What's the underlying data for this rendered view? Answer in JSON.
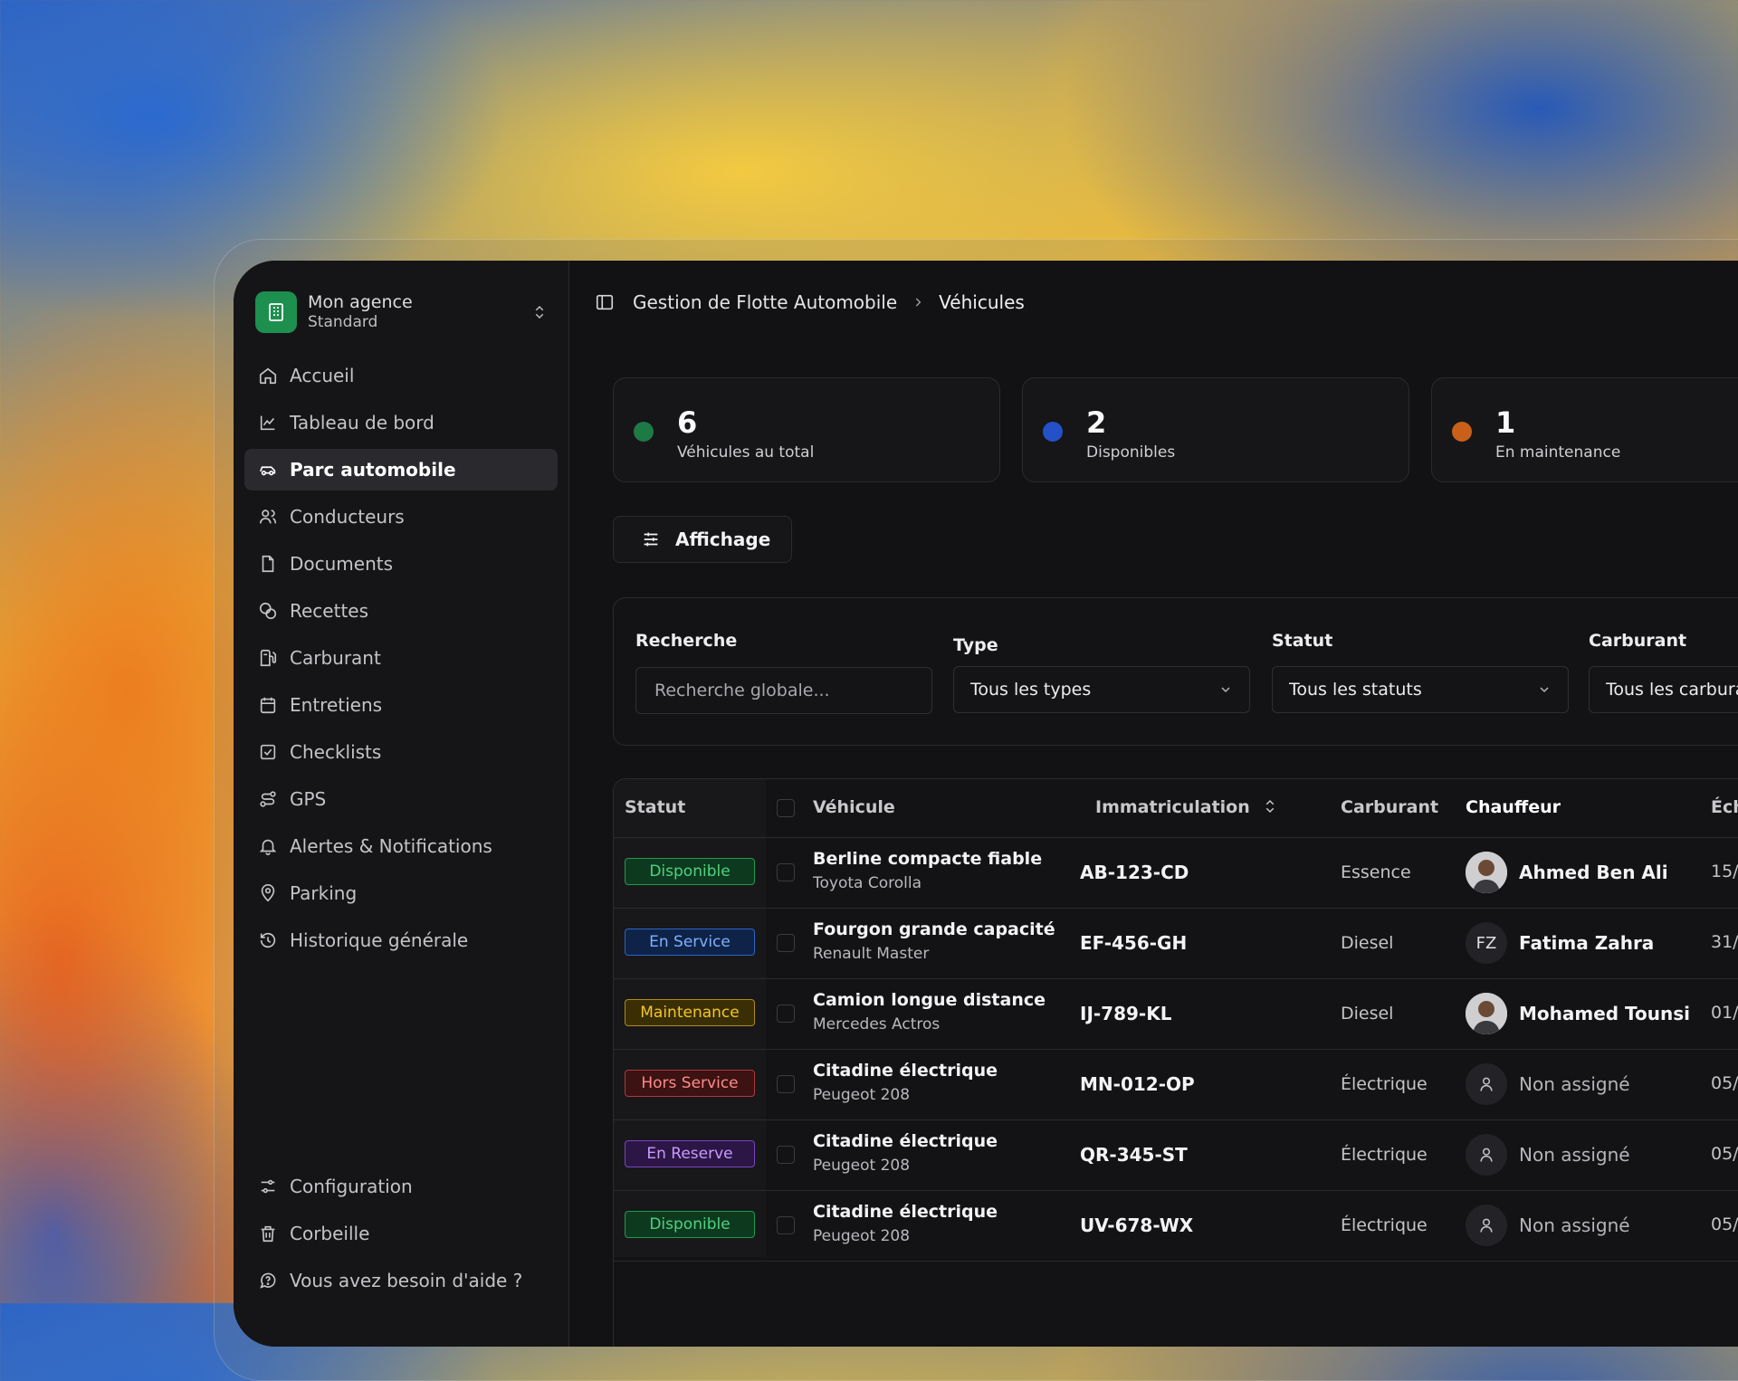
{
  "agency": {
    "name": "Mon agence",
    "plan": "Standard"
  },
  "colors": {
    "brand": "#1d8f4e",
    "background": "#121214",
    "accent_blue": "#2450c8",
    "accent_orange": "#c8601a"
  },
  "sidebar": {
    "items": [
      {
        "label": "Accueil",
        "icon": "home-icon",
        "active": false
      },
      {
        "label": "Tableau de bord",
        "icon": "chart-icon",
        "active": false
      },
      {
        "label": "Parc automobile",
        "icon": "car-icon",
        "active": true
      },
      {
        "label": "Conducteurs",
        "icon": "users-icon",
        "active": false
      },
      {
        "label": "Documents",
        "icon": "file-icon",
        "active": false
      },
      {
        "label": "Recettes",
        "icon": "coins-icon",
        "active": false
      },
      {
        "label": "Carburant",
        "icon": "fuel-icon",
        "active": false
      },
      {
        "label": "Entretiens",
        "icon": "calendar-icon",
        "active": false
      },
      {
        "label": "Checklists",
        "icon": "checkbox-icon",
        "active": false
      },
      {
        "label": "GPS",
        "icon": "route-icon",
        "active": false
      },
      {
        "label": "Alertes & Notifications",
        "icon": "bell-icon",
        "active": false
      },
      {
        "label": "Parking",
        "icon": "pin-icon",
        "active": false
      },
      {
        "label": "Historique générale",
        "icon": "history-icon",
        "active": false
      }
    ],
    "bottom": [
      {
        "label": "Configuration",
        "icon": "settings-icon"
      },
      {
        "label": "Corbeille",
        "icon": "trash-icon"
      },
      {
        "label": "Vous avez besoin d'aide ?",
        "icon": "help-icon"
      }
    ]
  },
  "breadcrumb": {
    "root": "Gestion de Flotte Automobile",
    "current": "Véhicules"
  },
  "stats": [
    {
      "value": "6",
      "label": "Véhicules au total",
      "color": "#1e7a45"
    },
    {
      "value": "2",
      "label": "Disponibles",
      "color": "#2450c8"
    },
    {
      "value": "1",
      "label": "En maintenance",
      "color": "#c8601a"
    }
  ],
  "toolbar": {
    "display_label": "Affichage"
  },
  "filters": {
    "search_label": "Recherche",
    "search_placeholder": "Recherche globale...",
    "type_label": "Type",
    "type_value": "Tous les types",
    "status_label": "Statut",
    "status_value": "Tous les statuts",
    "fuel_label": "Carburant",
    "fuel_value": "Tous les carbura"
  },
  "table": {
    "headers": {
      "status": "Statut",
      "vehicle": "Véhicule",
      "plate": "Immatriculation",
      "fuel": "Carburant",
      "driver": "Chauffeur",
      "next": "Éch"
    },
    "rows": [
      {
        "status": "Disponible",
        "name": "Berline compacte fiable",
        "model": "Toyota Corolla",
        "plate": "AB-123-CD",
        "fuel": "Essence",
        "driver": "Ahmed Ben Ali",
        "avatar": "photo",
        "initials": "",
        "next": "15/"
      },
      {
        "status": "En Service",
        "name": "Fourgon grande capacité",
        "model": "Renault Master",
        "plate": "EF-456-GH",
        "fuel": "Diesel",
        "driver": "Fatima Zahra",
        "avatar": "initials",
        "initials": "FZ",
        "next": "31/"
      },
      {
        "status": "Maintenance",
        "name": "Camion longue distance",
        "model": "Mercedes Actros",
        "plate": "IJ-789-KL",
        "fuel": "Diesel",
        "driver": "Mohamed Tounsi",
        "avatar": "photo",
        "initials": "",
        "next": "01/"
      },
      {
        "status": "Hors Service",
        "name": "Citadine électrique",
        "model": "Peugeot 208",
        "plate": "MN-012-OP",
        "fuel": "Électrique",
        "driver": "Non assigné",
        "avatar": "user-icon",
        "initials": "",
        "next": "05/"
      },
      {
        "status": "En Reserve",
        "name": "Citadine électrique",
        "model": "Peugeot 208",
        "plate": "QR-345-ST",
        "fuel": "Électrique",
        "driver": "Non assigné",
        "avatar": "user-icon",
        "initials": "",
        "next": "05/"
      },
      {
        "status": "Disponible",
        "name": "Citadine électrique",
        "model": "Peugeot 208",
        "plate": "UV-678-WX",
        "fuel": "Électrique",
        "driver": "Non assigné",
        "avatar": "user-icon",
        "initials": "",
        "next": "05/"
      }
    ]
  },
  "status_colors": {
    "Disponible": {
      "bg": "#0d3a1f",
      "border": "#1f9a4d",
      "text": "#4fd27e"
    },
    "En Service": {
      "bg": "#0e2347",
      "border": "#2d63c8",
      "text": "#7fb0ff"
    },
    "Maintenance": {
      "bg": "#3a2e05",
      "border": "#b08a12",
      "text": "#f2c629"
    },
    "Hors Service": {
      "bg": "#3c1212",
      "border": "#b0383a",
      "text": "#ff8a8a"
    },
    "En Reserve": {
      "bg": "#2c1645",
      "border": "#7a45c2",
      "text": "#c79bff"
    }
  }
}
